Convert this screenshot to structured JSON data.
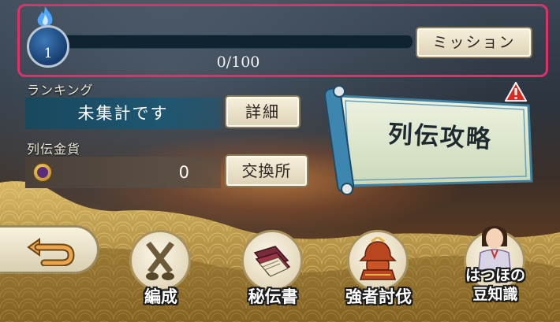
{
  "mission": {
    "level": "1",
    "progress_text": "0/100",
    "progress_fraction": 0,
    "button_label": "ミッション"
  },
  "ranking": {
    "label": "ランキング",
    "value": "未集計です",
    "detail_button": "詳細"
  },
  "coins": {
    "label": "列伝金貨",
    "value": "0",
    "exchange_button": "交換所"
  },
  "guide": {
    "label": "列伝攻略",
    "alert_icon": "exclamation-icon"
  },
  "bottom_nav": {
    "back_icon": "return-arrow-icon",
    "items": [
      {
        "label": "編成",
        "icon": "crossed-weapons-icon"
      },
      {
        "label": "秘伝書",
        "icon": "books-icon"
      },
      {
        "label": "強者討伐",
        "icon": "helmet-icon"
      },
      {
        "label": "はつほの\n豆知識",
        "line1": "はつほの",
        "line2": "豆知識",
        "icon": "character-portrait-icon"
      }
    ]
  },
  "colors": {
    "highlight_frame": "#e0306a",
    "accent_gold": "#c9a24a",
    "panel_blue": "#1f5670"
  }
}
